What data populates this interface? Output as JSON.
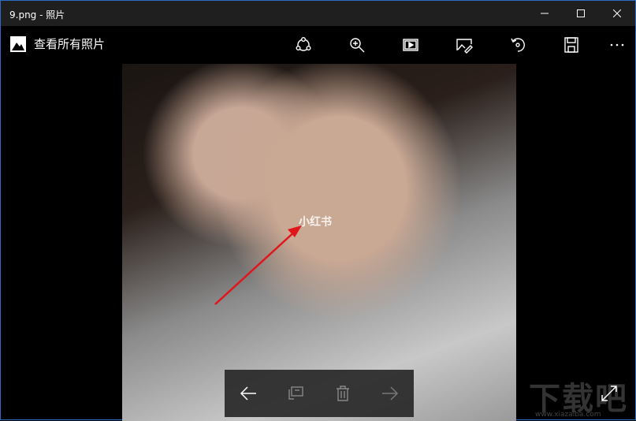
{
  "window": {
    "title": "9.png - 照片"
  },
  "toolbar": {
    "back_label": "查看所有照片",
    "buttons": [
      "share",
      "zoom",
      "slideshow",
      "edit",
      "rotate",
      "save",
      "more"
    ]
  },
  "photo": {
    "watermark": "小红书",
    "annotation_color": "#e0161b"
  },
  "nav": {
    "buttons": [
      "previous",
      "set-as",
      "delete",
      "next"
    ]
  },
  "site_watermark": {
    "name": "下载吧",
    "url": "www.xiazaiba.com"
  }
}
